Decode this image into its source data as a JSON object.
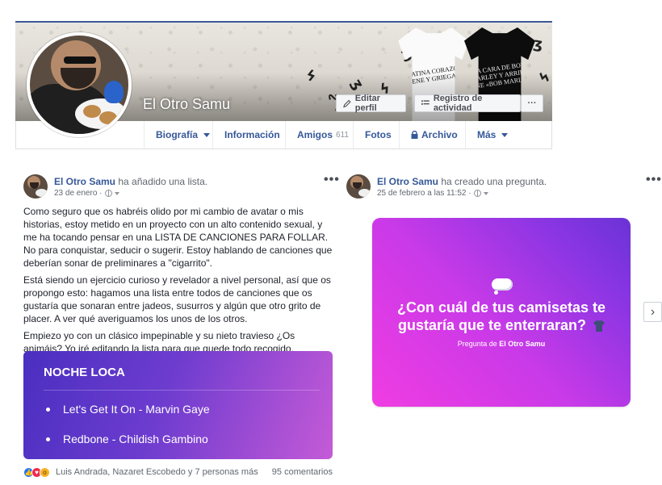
{
  "profile": {
    "name": "El Otro Samu",
    "edit_profile_label": "Editar perfil",
    "activity_log_label": "Registro de actividad",
    "more_label": "···",
    "tshirt_white_text": "I LATINA CORAZÓN ENE Y GRIEGA",
    "tshirt_black_text": "LA CARA DE BOB MARLEY Y ARRIBA PONE «BOB MARLEY»"
  },
  "nav": {
    "items": [
      {
        "label": "Biografía"
      },
      {
        "label": "Información"
      },
      {
        "label": "Amigos",
        "count": "611"
      },
      {
        "label": "Fotos"
      },
      {
        "label": "Archivo"
      },
      {
        "label": "Más"
      }
    ]
  },
  "posts": [
    {
      "author": "El Otro Samu",
      "action": "ha añadido una lista.",
      "date": "23 de enero ·",
      "dots": "•••",
      "paragraphs": [
        "Como seguro que os habréis olido por mi cambio de avatar o mis historias, estoy metido en un proyecto con un alto contenido sexual, y me ha tocando pensar en una LISTA DE CANCIONES PARA FOLLAR. No para conquistar, seducir o sugerir. Estoy hablando de canciones que deberían sonar de preliminares a \"cigarrito\".",
        "Está siendo un ejercicio curioso y revelador a nivel personal, así que os propongo esto: hagamos una lista entre todos de canciones que os gustaría que sonaran entre jadeos, susurros y algún que otro grito de placer. A ver qué averiguamos los unos de los otros.",
        "Empiezo yo con un clásico impepinable y su nieto travieso ¿Os animáis? Yo iré editando la lista para que quede todo recogido."
      ],
      "list": {
        "title": "NOCHE LOCA",
        "items": [
          "Let's Get It On - Marvin Gaye",
          "Redbone - Childish Gambino"
        ]
      },
      "reactors": "Luis Andrada, Nazaret Escobedo y 7 personas más",
      "comments": "95 comentarios"
    },
    {
      "author": "El Otro Samu",
      "action": "ha creado una pregunta.",
      "date": "25 de febrero a las 11:52 ·",
      "dots": "•••",
      "question": "¿Con cuál de tus camisetas te gustaría que te enterraran?",
      "asked_by_prefix": "Pregunta de",
      "asked_by_name": "El Otro Samu"
    }
  ],
  "next_arrow": "›",
  "colors": {
    "link": "#365899",
    "list_gradient": [
      "#4a2fc0",
      "#c45bd7"
    ],
    "question_gradient": [
      "#f03ce2",
      "#6a33d6"
    ]
  }
}
